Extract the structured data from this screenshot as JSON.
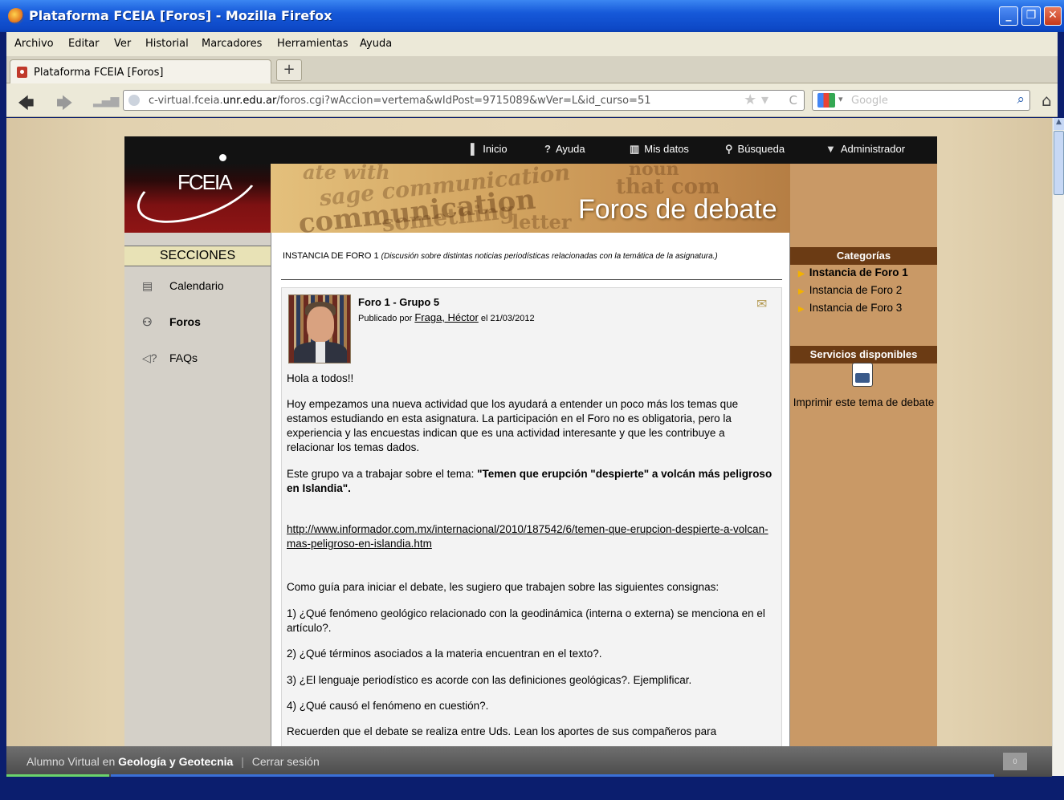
{
  "window": {
    "title": "Plataforma FCEIA [Foros] - Mozilla Firefox",
    "controls": {
      "minimize": "_",
      "maximize": "❐",
      "close": "✕"
    }
  },
  "menu": [
    "Archivo",
    "Editar",
    "Ver",
    "Historial",
    "Marcadores",
    "Herramientas",
    "Ayuda"
  ],
  "tab": {
    "label": "Plataforma FCEIA [Foros]",
    "new_tab": "+"
  },
  "nav": {
    "url_host": "c-virtual.fceia.",
    "url_domain": "unr.edu.ar",
    "url_path": "/foros.cgi?wAccion=vertema&wIdPost=9715089&wVer=L&id_curso=51",
    "search_placeholder": "Google"
  },
  "site": {
    "top_nav": [
      "Inicio",
      "Ayuda",
      "Mis datos",
      "Búsqueda",
      "Administrador"
    ],
    "logo_text": "FCEIA",
    "banner_words": [
      "ate with",
      "sage communication",
      "communication",
      "something",
      "noun",
      "that com",
      "letter"
    ],
    "banner_title": "Foros de debate"
  },
  "sections": {
    "header": "SECCIONES",
    "items": [
      "Calendario",
      "Foros",
      "FAQs"
    ]
  },
  "forum": {
    "instance_title": "INSTANCIA DE FORO 1",
    "instance_desc": "(Discusión sobre distintas noticias periodísticas relacionadas con la temática de la asignatura.)",
    "post_title": "Foro 1 - Grupo 5",
    "published_by": "Publicado por",
    "author": "Fraga, Héctor",
    "date": "el 21/03/2012",
    "p1": "Hola a todos!!",
    "p2": "Hoy empezamos una nueva actividad que los ayudará a entender un poco más los temas que estamos estudiando en esta asignatura. La participación en el Foro no es obligatoria, pero la experiencia y las encuestas indican que es una actividad interesante y que les contribuye a relacionar los temas dados.",
    "p3_intro": "Este grupo va a trabajar sobre el tema: ",
    "p3_bold": "\"Temen que erupción \"despierte\" a volcán más peligroso en Islandia\".",
    "link": "http://www.informador.com.mx/internacional/2010/187542/6/temen-que-erupcion-despierte-a-volcan-mas-peligroso-en-islandia.htm",
    "p4": "Como guía para iniciar el debate, les sugiero que trabajen sobre las siguientes consignas:",
    "q1": "1) ¿Qué fenómeno geológico relacionado con la geodinámica (interna o externa) se menciona en el artículo?.",
    "q2": "2) ¿Qué términos asociados a la materia encuentran en el texto?.",
    "q3": "3) ¿El lenguaje periodístico es acorde con las definiciones geológicas?. Ejemplificar.",
    "q4": "4) ¿Qué causó el fenómeno en cuestión?.",
    "p5": "Recuerden que el debate se realiza entre Uds. Lean los aportes de sus compañeros para"
  },
  "right": {
    "categories_header": "Categorías",
    "categories": [
      "Instancia de Foro 1",
      "Instancia de Foro 2",
      "Instancia de Foro 3"
    ],
    "services_header": "Servicios disponibles",
    "print_label": "Imprimir este tema de debate"
  },
  "statusbar": {
    "role": "Alumno Virtual en",
    "course": "Geología y Geotecnia",
    "separator": "|",
    "logout": "Cerrar sesión",
    "badge": "0"
  }
}
